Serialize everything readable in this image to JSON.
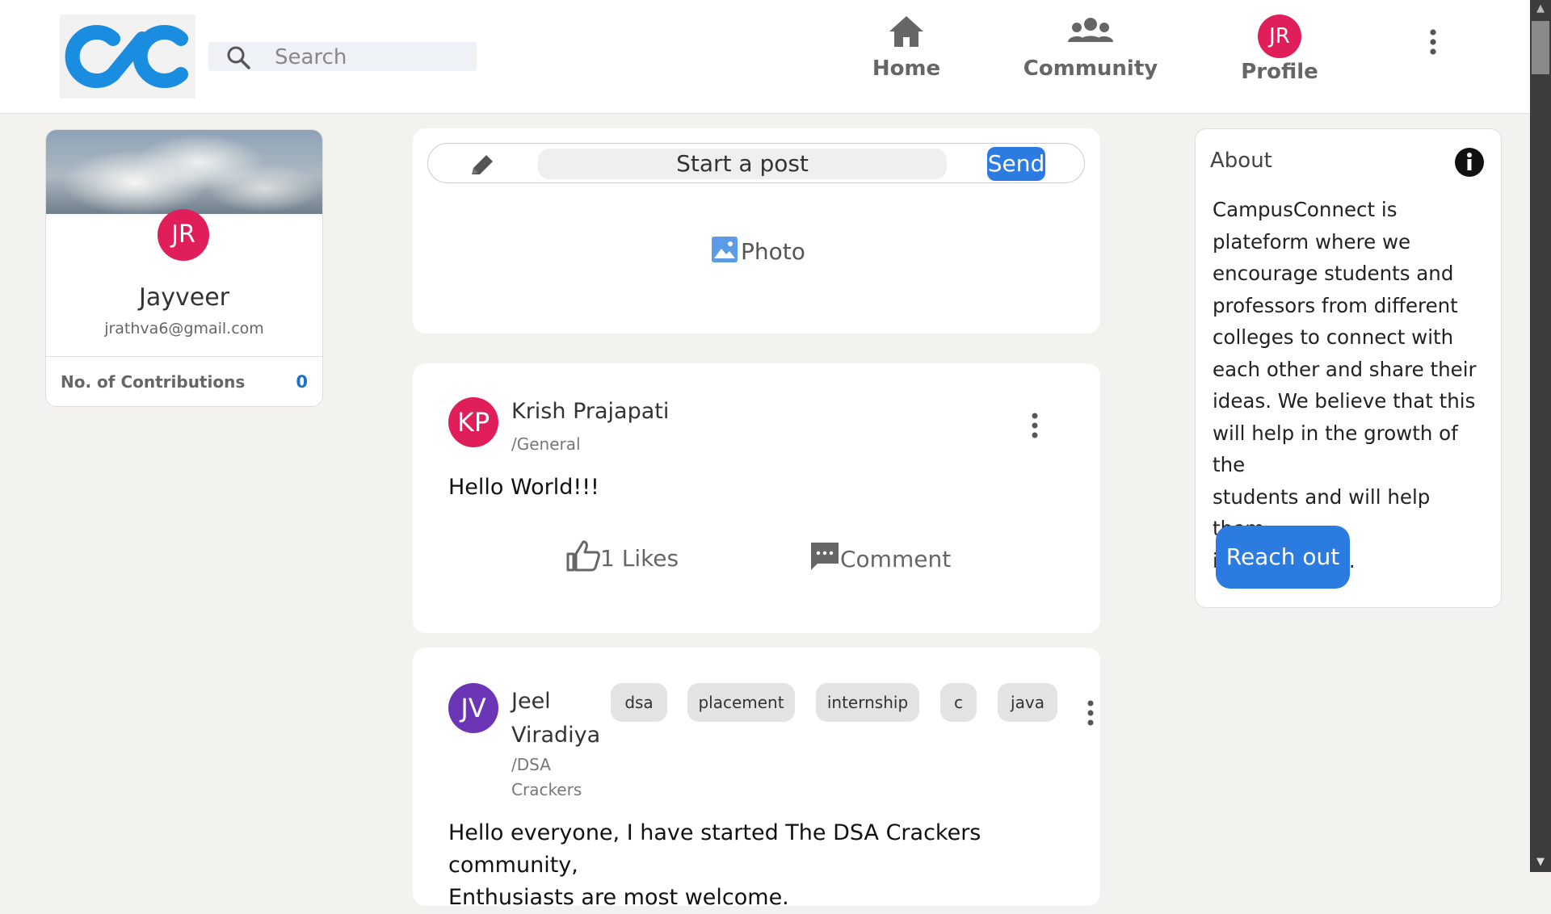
{
  "app": {
    "logo_text": "CC"
  },
  "search": {
    "placeholder": "Search",
    "value": ""
  },
  "nav": {
    "home": "Home",
    "community": "Community",
    "profile": "Profile",
    "profile_initials": "JR"
  },
  "profile_card": {
    "initials": "JR",
    "name": "Jayveer",
    "email": "jrathva6@gmail.com",
    "contributions_label": "No. of Contributions",
    "contributions_count": "0"
  },
  "composer": {
    "start_post": "Start a post",
    "send": "Send",
    "photo": "Photo"
  },
  "posts": [
    {
      "initials": "KP",
      "avatar_color": "#e01e5a",
      "author": "Krish Prajapati",
      "community": "/General",
      "text": "Hello World!!!",
      "likes": "1 Likes",
      "comment": "Comment",
      "tags": []
    },
    {
      "initials": "JV",
      "avatar_color": "#6c35b5",
      "author_line1": "Jeel",
      "author_line2": "Viradiya",
      "community_line1": "/DSA",
      "community_line2": "Crackers",
      "text_line1": "Hello everyone, I have started The DSA Crackers community,",
      "text_line2": "Enthusiasts are most welcome.",
      "tags": [
        "dsa",
        "placement",
        "internship",
        "c",
        "java"
      ]
    }
  ],
  "about": {
    "title": "About",
    "lines": [
      "CampusConnect is",
      "plateform where we",
      "encourage students and",
      "professors from different",
      "colleges to connect with",
      "each other and share their",
      "ideas. We believe that this",
      "will help in the growth of the",
      "students and will help them",
      "in their future."
    ],
    "button": "Reach out"
  },
  "colors": {
    "accent": "#2c7be0",
    "logo_blue": "#1a8de0",
    "avatar_red": "#e01e5a",
    "avatar_purple": "#6c35b5",
    "background": "#f3f2ef"
  },
  "icons": [
    "search-icon",
    "home-icon",
    "community-icon",
    "more-vertical-icon",
    "pencil-icon",
    "photo-icon",
    "thumbs-up-icon",
    "comment-icon",
    "info-icon"
  ]
}
